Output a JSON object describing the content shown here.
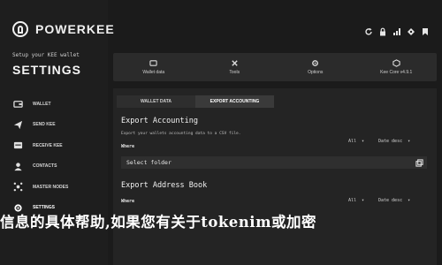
{
  "brand": {
    "name": "POWERKEE",
    "setup_text": "Setup your KEE wallet",
    "settings_title": "SETTINGS"
  },
  "sidebar": {
    "items": [
      {
        "label": "WALLET",
        "icon": "wallet-icon"
      },
      {
        "label": "SEND KEE",
        "icon": "send-icon"
      },
      {
        "label": "RECEIVE KEE",
        "icon": "receive-icon"
      },
      {
        "label": "CONTACTS",
        "icon": "contacts-icon"
      },
      {
        "label": "MASTER NODES",
        "icon": "master-nodes-icon"
      },
      {
        "label": "SETTINGS",
        "icon": "settings-icon",
        "active": true
      }
    ]
  },
  "topbar": {
    "icons": [
      "refresh-icon",
      "lock-icon",
      "network-icon",
      "status-icon",
      "bookmark-icon"
    ]
  },
  "main_tabs": [
    {
      "label": "Wallet data",
      "icon": "wallet-data-icon"
    },
    {
      "label": "Tools",
      "icon": "tools-icon"
    },
    {
      "label": "Options",
      "icon": "options-icon"
    },
    {
      "label": "Kee Core v4.9.1",
      "icon": "kee-core-icon"
    }
  ],
  "sub_tabs": [
    {
      "label": "WALLET DATA"
    },
    {
      "label": "EXPORT ACCOUNTING",
      "active": true
    }
  ],
  "export_accounting": {
    "title": "Export Accounting",
    "description": "Export your wallets accounting data to a CSV file.",
    "where_label": "Where",
    "filter_value": "All",
    "sort_value": "Date desc",
    "folder_placeholder": "Select folder"
  },
  "export_address_book": {
    "title": "Export Address Book",
    "where_label": "Where",
    "filter_value": "All",
    "sort_value": "Date desc"
  },
  "overlay_text": "信息的具体帮助,如果您有关于tokenim或加密"
}
